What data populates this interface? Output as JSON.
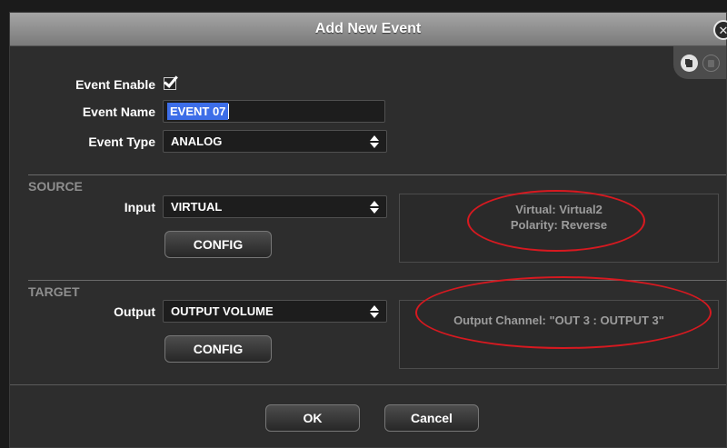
{
  "dialog": {
    "title": "Add New Event"
  },
  "fields": {
    "event_enable_label": "Event Enable",
    "event_enable_checked": true,
    "event_name_label": "Event Name",
    "event_name_value": "EVENT 07",
    "event_type_label": "Event Type",
    "event_type_value": "ANALOG"
  },
  "source": {
    "section_label": "SOURCE",
    "input_label": "Input",
    "input_value": "VIRTUAL",
    "config_label": "CONFIG",
    "info_lines": [
      "Virtual: Virtual2",
      "Polarity: Reverse"
    ]
  },
  "target": {
    "section_label": "TARGET",
    "output_label": "Output",
    "output_value": "OUTPUT VOLUME",
    "config_label": "CONFIG",
    "info_lines": [
      "Output Channel: \"OUT 3 : OUTPUT 3\""
    ]
  },
  "footer": {
    "ok_label": "OK",
    "cancel_label": "Cancel"
  },
  "icons": {
    "close": "close-icon",
    "copy": "copy-icon",
    "paste": "paste-icon"
  },
  "colors": {
    "annotation": "#d71920",
    "selection": "#3d6ee8",
    "section_label": "#8e8e8e"
  }
}
